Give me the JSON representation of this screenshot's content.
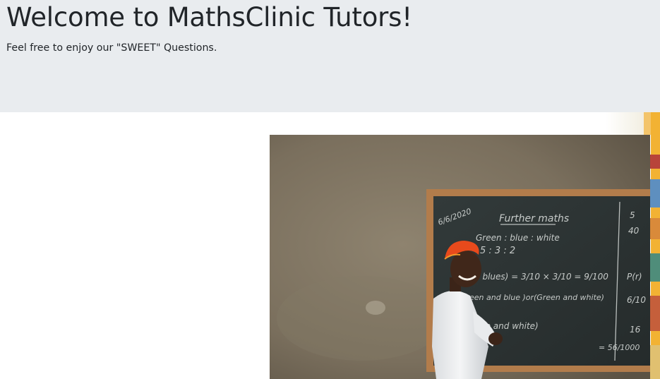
{
  "hero": {
    "title": "Welcome to MathsClinic Tutors!",
    "subtitle": "Feel free to enjoy our \"SWEET\" Questions."
  },
  "photo": {
    "subject": "tutor-at-chalkboard",
    "board_text": {
      "date": "6/6/2020",
      "heading": "Further maths",
      "line1": "Green : blue : white",
      "line2": "5 : 3 : 2",
      "line3": "2 blues) = 3/10 × 3/10 = 9/100",
      "line4": "een and blue )or(Green and white)",
      "line5": "ue and white)",
      "side1": "5",
      "side2": "40",
      "side3": "P(r)",
      "side4": "6/10",
      "side5": "16",
      "side6": "= 56/1000"
    }
  },
  "colors": {
    "jumbotron_bg": "#e9ecef",
    "text": "#212529",
    "wall": "#8a7e6b",
    "board": "#2d3434",
    "frame": "#b07a4a",
    "cap": "#e84a1c"
  }
}
